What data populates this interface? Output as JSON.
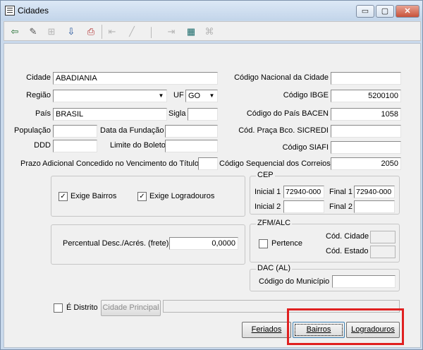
{
  "window": {
    "title": "Cidades",
    "minimize": "▭",
    "maximize": "▢",
    "close": "✕"
  },
  "toolbar": {
    "items": [
      {
        "name": "exit-icon",
        "glyph": "⇦"
      },
      {
        "name": "edit-icon",
        "glyph": "✎"
      },
      {
        "name": "tree-icon",
        "glyph": "⊞"
      },
      {
        "name": "download-icon",
        "glyph": "⇩"
      },
      {
        "name": "print-icon",
        "glyph": "⎙"
      },
      {
        "name": "first-icon",
        "glyph": "⇤"
      },
      {
        "name": "prev-icon",
        "glyph": "╱"
      },
      {
        "name": "next-icon",
        "glyph": "│"
      },
      {
        "name": "last-icon",
        "glyph": "⇥"
      },
      {
        "name": "grid-icon",
        "glyph": "▦"
      },
      {
        "name": "disabled-tool-icon",
        "glyph": "⌘"
      }
    ]
  },
  "form": {
    "cidade_label": "Cidade",
    "cidade_value": "ABADIANIA",
    "regiao_label": "Região",
    "regiao_value": "",
    "uf_label": "UF",
    "uf_value": "GO",
    "pais_label": "País",
    "pais_value": "BRASIL",
    "sigla_label": "Sigla",
    "sigla_value": "",
    "populacao_label": "População",
    "populacao_value": "",
    "data_fundacao_label": "Data da Fundação",
    "data_fundacao_value": "",
    "ddd_label": "DDD",
    "ddd_value": "",
    "limite_boleto_label": "Limite do Boleto",
    "limite_boleto_value": "",
    "prazo_label": "Prazo Adicional Concedido no Vencimento do Título",
    "prazo_value": "",
    "cod_nacional_label": "Código Nacional da Cidade",
    "cod_nacional_value": "",
    "cod_ibge_label": "Código IBGE",
    "cod_ibge_value": "5200100",
    "cod_pais_bacen_label": "Código do País BACEN",
    "cod_pais_bacen_value": "1058",
    "cod_praca_label": "Cód. Praça Bco. SICREDI",
    "cod_praca_value": "",
    "cod_siafi_label": "Código SIAFI",
    "cod_siafi_value": "",
    "cod_correios_label": "Código Sequencial dos Correios",
    "cod_correios_value": "2050"
  },
  "bairros_group": {
    "exige_bairros_label": "Exige Bairros",
    "exige_bairros_checked": "✓",
    "exige_logradouros_label": "Exige Logradouros",
    "exige_logradouros_checked": "✓"
  },
  "frete_group": {
    "label": "Percentual Desc./Acrés. (frete)",
    "value": "0,0000"
  },
  "cep_group": {
    "title": "CEP",
    "inicial1_label": "Inicial 1",
    "inicial1_value": "72940-000",
    "final1_label": "Final 1",
    "final1_value": "72940-000",
    "inicial2_label": "Inicial 2",
    "inicial2_value": "",
    "final2_label": "Final 2",
    "final2_value": ""
  },
  "zfm_group": {
    "title": "ZFM/ALC",
    "pertence_label": "Pertence",
    "cod_cidade_label": "Cód. Cidade",
    "cod_cidade_value": "",
    "cod_estado_label": "Cód. Estado",
    "cod_estado_value": ""
  },
  "dac_group": {
    "title": "DAC (AL)",
    "cod_municipio_label": "Código do Município",
    "cod_municipio_value": ""
  },
  "distrito": {
    "label": "É Distrito",
    "cidade_principal_button": "Cidade Principal",
    "cidade_principal_value": ""
  },
  "buttons": {
    "feriados": "Feriados",
    "bairros": "Bairros",
    "logradouros": "Logradouros"
  },
  "colors": {
    "highlight": "#e02020"
  }
}
